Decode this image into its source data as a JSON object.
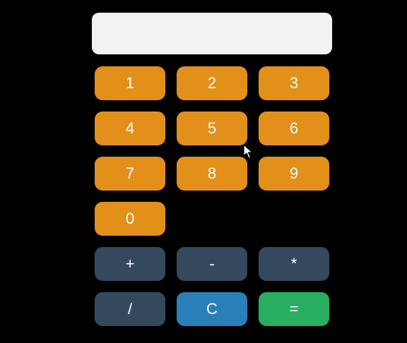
{
  "display": {
    "value": ""
  },
  "keys": {
    "one": "1",
    "two": "2",
    "three": "3",
    "four": "4",
    "five": "5",
    "six": "6",
    "seven": "7",
    "eight": "8",
    "nine": "9",
    "zero": "0",
    "plus": "+",
    "minus": "-",
    "multiply": "*",
    "divide": "/",
    "clear": "C",
    "equals": "="
  },
  "colors": {
    "digit": "#e2901a",
    "operator": "#34495e",
    "clear": "#2980b9",
    "equals": "#27ae60",
    "display_bg": "#f2f2f2",
    "page_bg": "#000000"
  },
  "icons": {
    "pointer": "mouse-pointer-icon"
  }
}
